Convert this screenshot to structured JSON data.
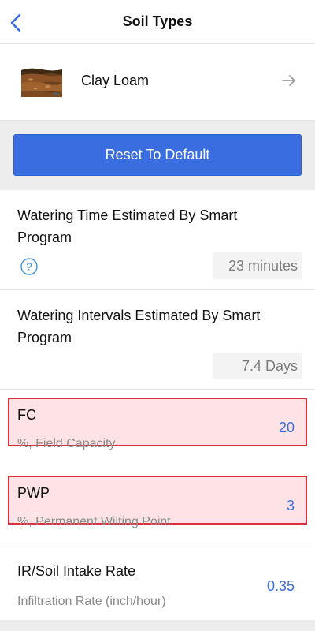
{
  "header": {
    "title": "Soil Types"
  },
  "soil": {
    "name": "Clay Loam"
  },
  "reset_button": {
    "label": "Reset To Default"
  },
  "watering_time": {
    "title": "Watering Time Estimated By Smart Program",
    "value": "23 minutes"
  },
  "watering_intervals": {
    "title": "Watering Intervals Estimated By Smart Program",
    "value": "7.4 Days"
  },
  "fc": {
    "label": "FC",
    "sub": "%, Field Capacity",
    "value": "20"
  },
  "pwp": {
    "label": "PWP",
    "sub": "%, Permanent Wilting Point",
    "value": "3"
  },
  "ir": {
    "label": "IR/Soil Intake Rate",
    "sub": "Infiltration Rate (inch/hour)",
    "value": "0.35"
  },
  "colors": {
    "accent": "#3a6ee0",
    "highlight_border": "#dc2d38",
    "highlight_fill": "#fde3e6"
  }
}
